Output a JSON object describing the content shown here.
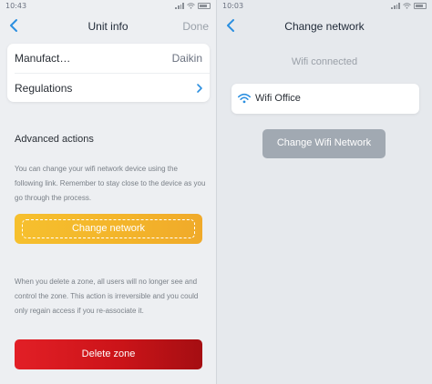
{
  "left_screen": {
    "status": {
      "time": "10:43"
    },
    "navbar": {
      "title": "Unit info",
      "done_label": "Done"
    },
    "info_card": {
      "rows": [
        {
          "label": "Manufact…",
          "value": "Daikin"
        },
        {
          "label": "Regulations"
        }
      ]
    },
    "advanced_actions": {
      "title": "Advanced actions",
      "description": "You can change your wifi network device using the following link. Remember to stay close to the device as you go through the process.",
      "change_network_label": "Change network",
      "delete_description": "When you delete a zone, all users will no longer see and control the zone. This action is irreversible and you could only regain access if you re-associate it.",
      "delete_zone_label": "Delete zone"
    }
  },
  "right_screen": {
    "status": {
      "time": "10:03"
    },
    "navbar": {
      "title": "Change network"
    },
    "status_text": "Wifi connected",
    "current_network": "Wifi Office",
    "change_wifi_label": "Change Wifi Network"
  },
  "colors": {
    "accent_blue": "#2b8fe0",
    "change_button_yellow": "#f3b42a",
    "delete_button_red": "#cc1419",
    "disabled_gray": "#a1a9b2"
  },
  "icons": {
    "back": "chevron-left-icon",
    "row_arrow": "chevron-right-icon",
    "network": "wifi-icon"
  }
}
